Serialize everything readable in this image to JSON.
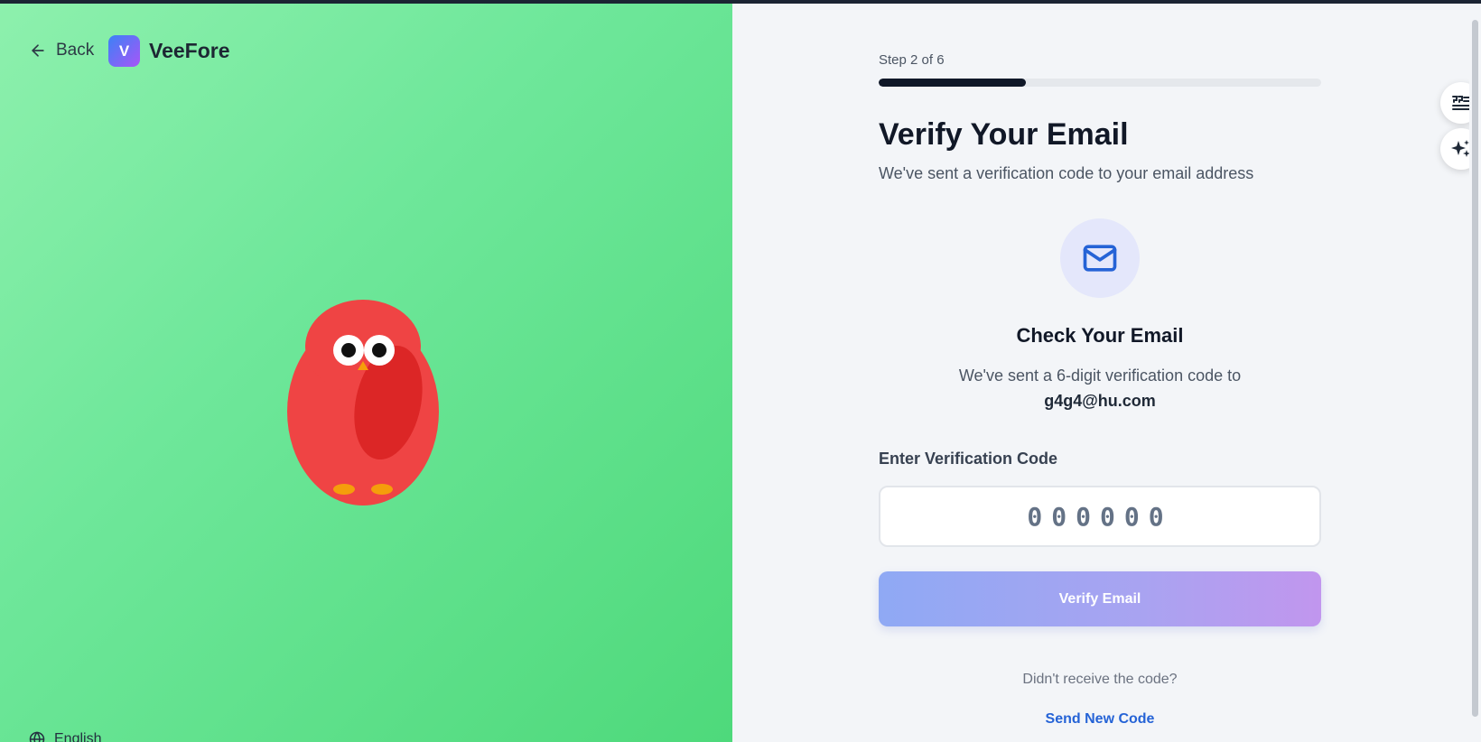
{
  "nav": {
    "back_label": "Back"
  },
  "brand": {
    "logo_letter": "V",
    "name": "VeeFore"
  },
  "footer": {
    "language_label": "English"
  },
  "step": {
    "label": "Step 2 of 6",
    "current": 2,
    "total": 6,
    "progress_fraction": 0.333
  },
  "header": {
    "title": "Verify Your Email",
    "subtitle": "We've sent a verification code to your email address"
  },
  "check": {
    "title": "Check Your Email",
    "sent_text": "We've sent a 6-digit verification code to",
    "email": "g4g4@hu.com"
  },
  "code": {
    "label": "Enter Verification Code",
    "placeholder": "000000",
    "value": ""
  },
  "actions": {
    "verify_label": "Verify Email",
    "resend_prompt": "Didn't receive the code?",
    "resend_label": "Send New Code"
  },
  "icons": {
    "back": "arrow-left-icon",
    "language": "globe-icon",
    "mail": "mail-icon",
    "float_top": "quote-list-icon",
    "float_bottom": "sparkles-icon"
  },
  "colors": {
    "left_gradient_start": "#8df0ad",
    "left_gradient_end": "#4ed97b",
    "right_background": "#f3f5f8",
    "progress_fill": "#101828",
    "link": "#2563d6",
    "button_gradient_start": "#8fa9f4",
    "button_gradient_end": "#c196ee",
    "mascot_body": "#ef4444"
  }
}
